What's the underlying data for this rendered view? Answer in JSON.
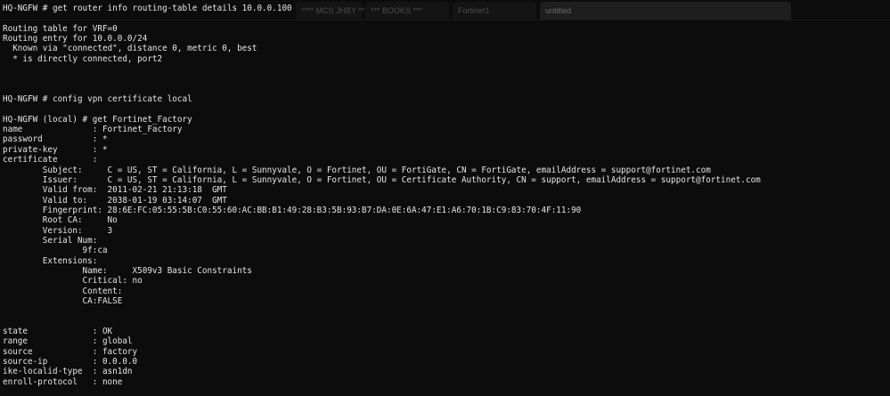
{
  "tabs": [
    {
      "label": "**** MCS JHBY ****"
    },
    {
      "label": "*** BOOKS ***"
    },
    {
      "label": "Fortinet1"
    },
    {
      "label": "untitled"
    }
  ],
  "terminal": {
    "lines": [
      "HQ-NGFW # get router info routing-table details 10.0.0.100",
      "",
      "Routing table for VRF=0",
      "Routing entry for 10.0.0.0/24",
      "  Known via \"connected\", distance 0, metric 0, best",
      "  * is directly connected, port2",
      "",
      "",
      "",
      "HQ-NGFW # config vpn certificate local",
      "",
      "HQ-NGFW (local) # get Fortinet_Factory",
      "name              : Fortinet_Factory",
      "password          : *",
      "private-key       : *",
      "certificate       :",
      "        Subject:     C = US, ST = California, L = Sunnyvale, O = Fortinet, OU = FortiGate, CN = FortiGate, emailAddress = support@fortinet.com",
      "        Issuer:      C = US, ST = California, L = Sunnyvale, O = Fortinet, OU = Certificate Authority, CN = support, emailAddress = support@fortinet.com",
      "        Valid from:  2011-02-21 21:13:18  GMT",
      "        Valid to:    2038-01-19 03:14:07  GMT",
      "        Fingerprint: 28:6E:FC:05:55:5B:C0:55:60:AC:BB:B1:49:28:B3:5B:93:B7:DA:0E:6A:47:E1:A6:70:1B:C9:83:70:4F:11:90",
      "        Root CA:     No",
      "        Version:     3",
      "        Serial Num:",
      "                9f:ca",
      "        Extensions:",
      "                Name:     X509v3 Basic Constraints",
      "                Critical: no",
      "                Content:",
      "                CA:FALSE",
      "",
      "",
      "state             : OK",
      "range             : global",
      "source            : factory",
      "source-ip         : 0.0.0.0",
      "ike-localid-type  : asn1dn",
      "enroll-protocol   : none"
    ]
  }
}
